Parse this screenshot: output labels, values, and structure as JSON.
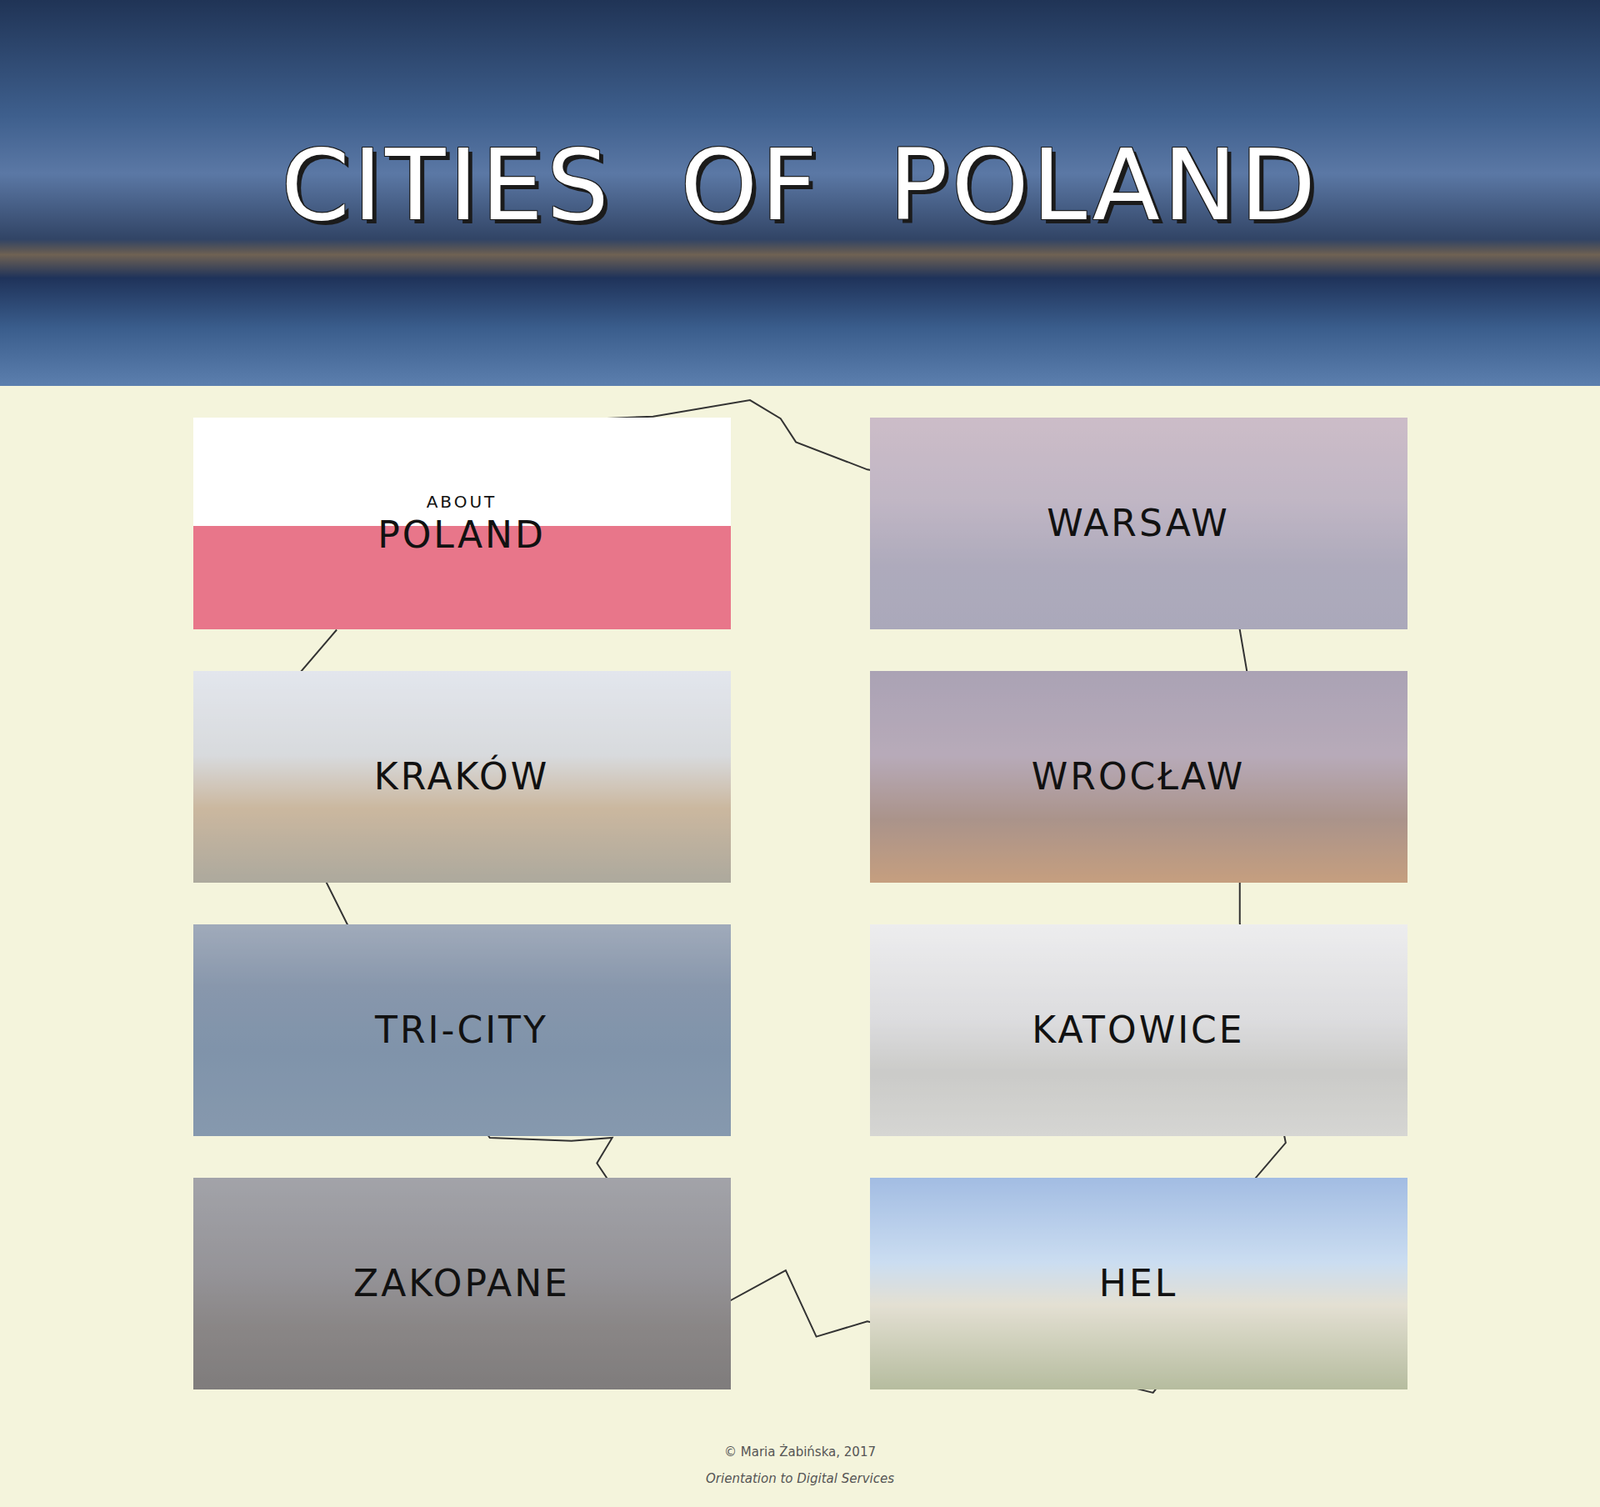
{
  "header": {
    "title": "CITIES OF POLAND"
  },
  "cards": [
    {
      "kind": "flag",
      "sublabel": "ABOUT",
      "label": "POLAND"
    },
    {
      "kind": "photo",
      "label": "WARSAW"
    },
    {
      "kind": "photo",
      "label": "KRAKÓW"
    },
    {
      "kind": "photo",
      "label": "WROCŁAW"
    },
    {
      "kind": "photo",
      "label": "TRI-CITY"
    },
    {
      "kind": "photo",
      "label": "KATOWICE"
    },
    {
      "kind": "photo",
      "label": "ZAKOPANE"
    },
    {
      "kind": "photo",
      "label": "HEL"
    }
  ],
  "footer": {
    "copyright": "© Maria Żabińska, 2017",
    "course": "Orientation to Digital Services"
  }
}
